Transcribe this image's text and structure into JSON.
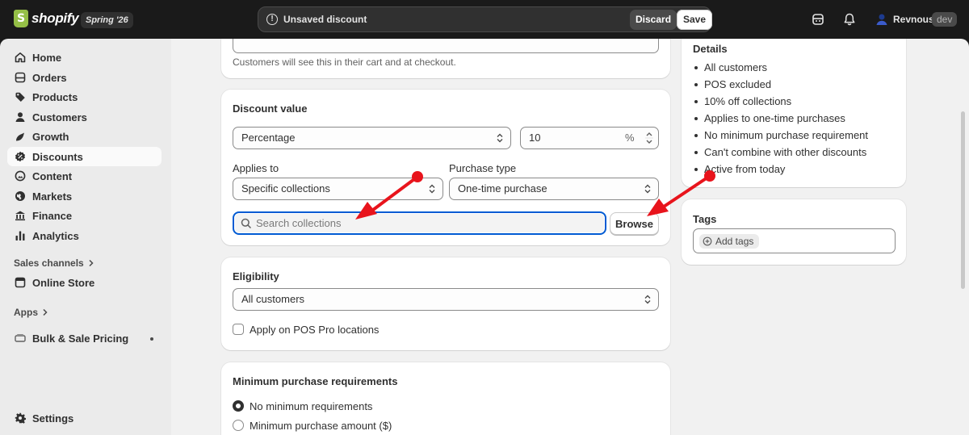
{
  "topbar": {
    "brand": "shopify",
    "release_badge": "Spring '26",
    "savebar_message": "Unsaved discount",
    "discard_label": "Discard",
    "save_label": "Save",
    "store_name": "Revnous",
    "env_badge": "dev"
  },
  "sidebar": {
    "items": [
      {
        "label": "Home",
        "icon": "home-icon"
      },
      {
        "label": "Orders",
        "icon": "orders-icon"
      },
      {
        "label": "Products",
        "icon": "tag-icon"
      },
      {
        "label": "Customers",
        "icon": "person-icon"
      },
      {
        "label": "Growth",
        "icon": "growth-icon"
      },
      {
        "label": "Discounts",
        "icon": "discount-icon"
      },
      {
        "label": "Content",
        "icon": "content-icon"
      },
      {
        "label": "Markets",
        "icon": "globe-icon"
      },
      {
        "label": "Finance",
        "icon": "bank-icon"
      },
      {
        "label": "Analytics",
        "icon": "chart-icon"
      }
    ],
    "sales_channels_label": "Sales channels",
    "online_store_label": "Online Store",
    "apps_label": "Apps",
    "app_item_label": "Bulk & Sale Pricing",
    "settings_label": "Settings",
    "active_item": "Discounts"
  },
  "method_card": {
    "help_text": "Customers will see this in their cart and at checkout."
  },
  "discount_value": {
    "title": "Discount value",
    "type_value": "Percentage",
    "amount_value": "10",
    "amount_suffix": "%",
    "applies_to_label": "Applies to",
    "applies_to_value": "Specific collections",
    "purchase_type_label": "Purchase type",
    "purchase_type_value": "One-time purchase",
    "search_placeholder": "Search collections",
    "browse_label": "Browse"
  },
  "eligibility": {
    "title": "Eligibility",
    "value": "All customers",
    "pos_checkbox_label": "Apply on POS Pro locations",
    "pos_checked": false
  },
  "minimum_requirements": {
    "title": "Minimum purchase requirements",
    "options": [
      "No minimum requirements",
      "Minimum purchase amount ($)"
    ],
    "selected": "No minimum requirements"
  },
  "details": {
    "title": "Details",
    "items": [
      "All customers",
      "POS excluded",
      "10% off collections",
      "Applies to one-time purchases",
      "No minimum purchase requirement",
      "Can't combine with other discounts",
      "Active from today"
    ]
  },
  "tags": {
    "title": "Tags",
    "add_label": "Add tags"
  },
  "colors": {
    "focus_blue": "#005bd3",
    "annotation_red": "#e8141c",
    "topbar_bg": "#1a1a1a"
  }
}
